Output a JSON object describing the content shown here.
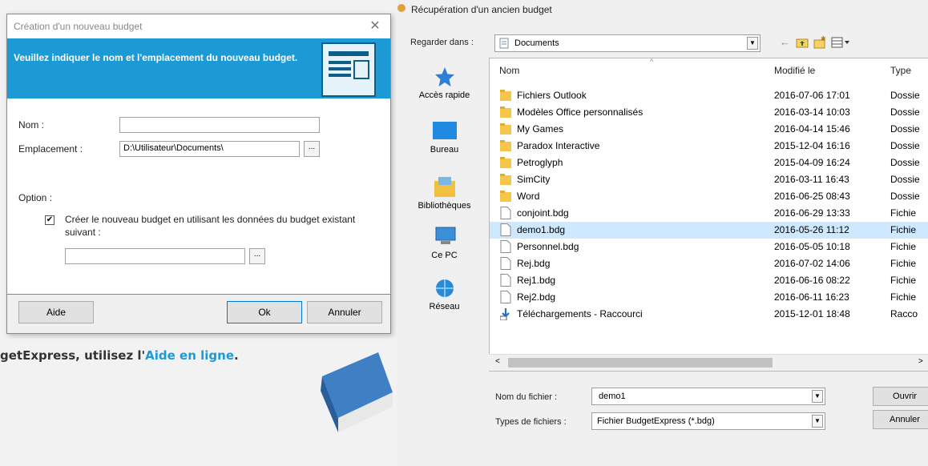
{
  "background": {
    "help_prefix": "getExpress, utilisez l'",
    "help_link": "Aide en ligne",
    "help_suffix": "."
  },
  "new_budget_dialog": {
    "title": "Création d'un nouveau budget",
    "banner": "Veuillez indiquer le nom et l'emplacement du nouveau budget.",
    "nom_label": "Nom :",
    "nom_value": "",
    "emplacement_label": "Emplacement :",
    "emplacement_value": "D:\\Utilisateur\\Documents\\",
    "browse_label": "...",
    "option_label": "Option :",
    "checkbox_checked": true,
    "checkbox_label": "Créer le nouveau budget en utilisant les données du budget existant suivant :",
    "existing_budget_value": "",
    "buttons": {
      "aide": "Aide",
      "ok": "Ok",
      "annuler": "Annuler"
    },
    "accent_color": "#1c9ad6"
  },
  "open_dialog": {
    "title": "Récupération d'un ancien budget",
    "look_in_label": "Regarder dans :",
    "look_in_value": "Documents",
    "places": [
      {
        "label": "Accès rapide",
        "icon": "star-icon"
      },
      {
        "label": "Bureau",
        "icon": "desktop-icon"
      },
      {
        "label": "Bibliothèques",
        "icon": "library-icon"
      },
      {
        "label": "Ce PC",
        "icon": "computer-icon"
      },
      {
        "label": "Réseau",
        "icon": "network-icon"
      }
    ],
    "columns": [
      "Nom",
      "Modifié le",
      "Type"
    ],
    "files": [
      {
        "name": "Fichiers Outlook",
        "modified": "2016-07-06 17:01",
        "type": "Dossie",
        "kind": "folder"
      },
      {
        "name": "Modèles Office personnalisés",
        "modified": "2016-03-14 10:03",
        "type": "Dossie",
        "kind": "folder"
      },
      {
        "name": "My Games",
        "modified": "2016-04-14 15:46",
        "type": "Dossie",
        "kind": "folder"
      },
      {
        "name": "Paradox Interactive",
        "modified": "2015-12-04 16:16",
        "type": "Dossie",
        "kind": "folder"
      },
      {
        "name": "Petroglyph",
        "modified": "2015-04-09 16:24",
        "type": "Dossie",
        "kind": "folder"
      },
      {
        "name": "SimCity",
        "modified": "2016-03-11 16:43",
        "type": "Dossie",
        "kind": "folder"
      },
      {
        "name": "Word",
        "modified": "2016-06-25 08:43",
        "type": "Dossie",
        "kind": "folder"
      },
      {
        "name": "conjoint.bdg",
        "modified": "2016-06-29 13:33",
        "type": "Fichie",
        "kind": "file"
      },
      {
        "name": "demo1.bdg",
        "modified": "2016-05-26 11:12",
        "type": "Fichie",
        "kind": "file",
        "selected": true
      },
      {
        "name": "Personnel.bdg",
        "modified": "2016-05-05 10:18",
        "type": "Fichie",
        "kind": "file"
      },
      {
        "name": "Rej.bdg",
        "modified": "2016-07-02 14:06",
        "type": "Fichie",
        "kind": "file"
      },
      {
        "name": "Rej1.bdg",
        "modified": "2016-06-16 08:22",
        "type": "Fichie",
        "kind": "file"
      },
      {
        "name": "Rej2.bdg",
        "modified": "2016-06-11 16:23",
        "type": "Fichie",
        "kind": "file"
      },
      {
        "name": "Téléchargements - Raccourci",
        "modified": "2015-12-01 18:48",
        "type": "Racco",
        "kind": "shortcut"
      }
    ],
    "filename_label": "Nom du fichier :",
    "filename_value": "demo1",
    "filetype_label": "Types de fichiers :",
    "filetype_value": "Fichier BudgetExpress (*.bdg)",
    "open_button": "Ouvrir",
    "cancel_button": "Annuler"
  }
}
